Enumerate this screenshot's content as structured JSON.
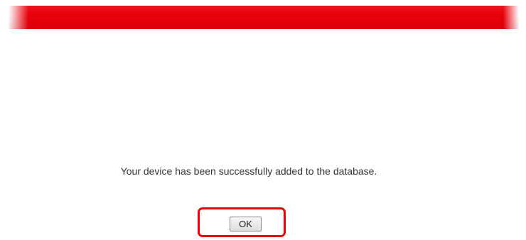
{
  "header": {
    "bar_color": "#e8000a"
  },
  "dialog": {
    "message": "Your device has been successfully added to the database.",
    "ok_label": "OK",
    "highlight_color": "#e8000a"
  }
}
